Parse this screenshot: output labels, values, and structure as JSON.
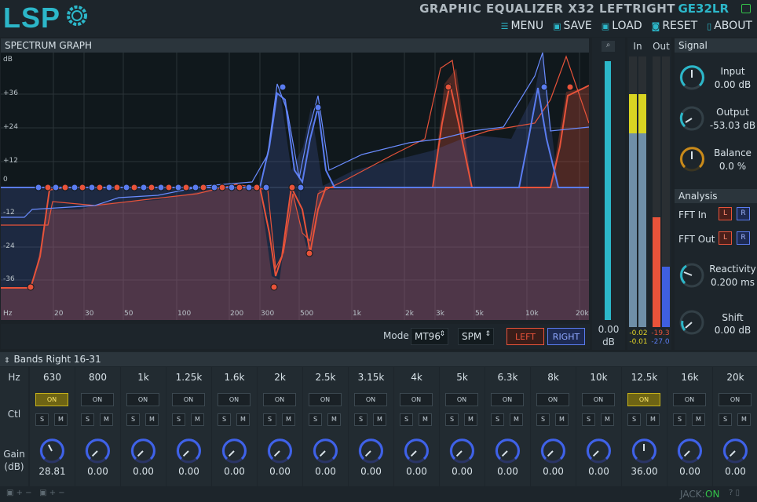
{
  "header": {
    "logo": "LSP",
    "title": "GRAPHIC EQUALIZER X32 LEFTRIGHT",
    "code": "GE32LR"
  },
  "menu": {
    "menu": "MENU",
    "save": "SAVE",
    "load": "LOAD",
    "reset": "RESET",
    "about": "ABOUT"
  },
  "graph": {
    "title": "SPECTRUM GRAPH",
    "db_label": "dB",
    "hz_label": "Hz",
    "y_labels": [
      "+36",
      "+24",
      "+12",
      "0",
      "-12",
      "-24",
      "-36"
    ],
    "x_labels": [
      "20",
      "30",
      "50",
      "100",
      "200",
      "300",
      "500",
      "1k",
      "2k",
      "3k",
      "5k",
      "10k",
      "20k"
    ]
  },
  "controls": {
    "mode_label": "Mode",
    "mode_value": "MT96",
    "slope_value": "SPM",
    "left": "LEFT",
    "right": "RIGHT"
  },
  "meters": {
    "gain_value": "0.00",
    "gain_unit": "dB",
    "in_label": "In",
    "out_label": "Out",
    "in_l": "-0.02",
    "in_r": "-0.01",
    "out_l": "-19.3",
    "out_r": "-27.0"
  },
  "signal": {
    "title": "Signal",
    "input_label": "Input",
    "input_value": "0.00 dB",
    "output_label": "Output",
    "output_value": "-53.03 dB",
    "balance_label": "Balance",
    "balance_value": "0.0 %"
  },
  "analysis": {
    "title": "Analysis",
    "fft_in": "FFT In",
    "fft_out": "FFT Out",
    "l": "L",
    "r": "R",
    "reactivity_label": "Reactivity",
    "reactivity_value": "0.200 ms",
    "shift_label": "Shift",
    "shift_value": "0.00 dB"
  },
  "bands": {
    "title": "Bands Right 16-31",
    "hz_label": "Hz",
    "ctl_label": "Ctl",
    "gain_label": "Gain",
    "gain_unit": "(dB)",
    "on": "ON",
    "s": "S",
    "m": "M",
    "items": [
      {
        "freq": "630",
        "gain": "28.81",
        "active": true
      },
      {
        "freq": "800",
        "gain": "0.00",
        "active": false
      },
      {
        "freq": "1k",
        "gain": "0.00",
        "active": false
      },
      {
        "freq": "1.25k",
        "gain": "0.00",
        "active": false
      },
      {
        "freq": "1.6k",
        "gain": "0.00",
        "active": false
      },
      {
        "freq": "2k",
        "gain": "0.00",
        "active": false
      },
      {
        "freq": "2.5k",
        "gain": "0.00",
        "active": false
      },
      {
        "freq": "3.15k",
        "gain": "0.00",
        "active": false
      },
      {
        "freq": "4k",
        "gain": "0.00",
        "active": false
      },
      {
        "freq": "5k",
        "gain": "0.00",
        "active": false
      },
      {
        "freq": "6.3k",
        "gain": "0.00",
        "active": false
      },
      {
        "freq": "8k",
        "gain": "0.00",
        "active": false
      },
      {
        "freq": "10k",
        "gain": "0.00",
        "active": false
      },
      {
        "freq": "12.5k",
        "gain": "36.00",
        "active": true
      },
      {
        "freq": "16k",
        "gain": "0.00",
        "active": false
      },
      {
        "freq": "20k",
        "gain": "0.00",
        "active": false
      }
    ]
  },
  "status": {
    "jack_label": "JACK:",
    "jack_value": "ON"
  },
  "colors": {
    "accent": "#2cb7c9",
    "left": "#e8533a",
    "right": "#5a7cf0",
    "active": "#c6b21b"
  }
}
